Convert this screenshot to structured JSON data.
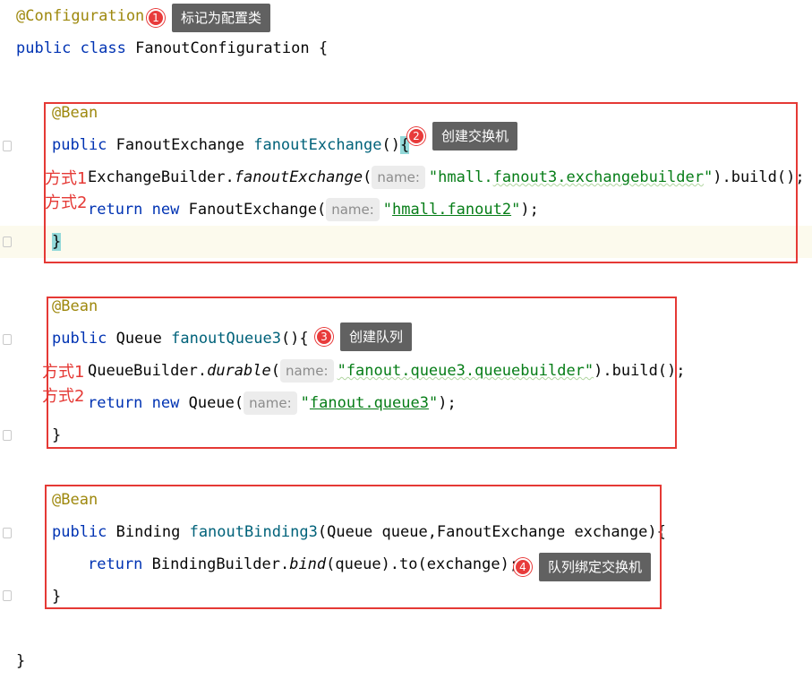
{
  "code": {
    "class_annotation": "@Configuration",
    "class_decl": {
      "public": "public",
      "class_kw": "class",
      "name": "FanoutConfiguration",
      "open": " {"
    },
    "bean_annotation": "@Bean",
    "hint_name": "name:",
    "exchange_method": {
      "public": "public",
      "type": "FanoutExchange",
      "name": "fanoutExchange",
      "parens": "()",
      "open_brace": "{",
      "builder_class": "ExchangeBuilder",
      "builder_method": "fanoutExchange",
      "builder_open": "(",
      "builder_arg_pre": "\"hmall.",
      "builder_arg_mid": "fanout3.exchangebuilder",
      "builder_arg_post": "\"",
      "builder_tail": ").build();",
      "return_kw": "return",
      "new_kw": "new",
      "ctor_type": "FanoutExchange",
      "ctor_open": "(",
      "ctor_arg_pre": "\"",
      "ctor_arg_mid": "hmall.fanout2",
      "ctor_arg_post": "\"",
      "ctor_tail": ");",
      "close_brace": "}"
    },
    "queue_method": {
      "public": "public",
      "type": "Queue",
      "name": "fanoutQueue3",
      "parens": "(){",
      "builder_class": "QueueBuilder",
      "builder_method": "durable",
      "builder_open": "(",
      "builder_arg": "\"fanout.queue3.queuebuilder\"",
      "builder_tail": ").build();",
      "return_kw": "return",
      "new_kw": "new",
      "ctor_type": "Queue",
      "ctor_open": "(",
      "ctor_arg_pre": "\"",
      "ctor_arg_mid": "fanout.queue3",
      "ctor_arg_post": "\"",
      "ctor_tail": ");",
      "close_brace": "}"
    },
    "binding_method": {
      "public": "public",
      "type": "Binding",
      "name": "fanoutBinding3",
      "params": "(Queue queue,FanoutExchange exchange){",
      "return_kw": "return",
      "builder_class": "BindingBuilder.",
      "bind_method": "bind",
      "bind_tail": "(queue).to(exchange);",
      "close_brace": "}"
    },
    "class_close": "}"
  },
  "callouts": [
    {
      "num": "1",
      "text": "标记为配置类"
    },
    {
      "num": "2",
      "text": "创建交换机"
    },
    {
      "num": "3",
      "text": "创建队列"
    },
    {
      "num": "4",
      "text": "队列绑定交换机"
    }
  ],
  "method_notes": {
    "exchange_way1": "方式1",
    "exchange_way2": "方式2",
    "queue_way1": "方式1",
    "queue_way2": "方式2"
  },
  "colors": {
    "keyword": "#0033b3",
    "annotation": "#9e880d",
    "method_name": "#00627a",
    "string": "#067d17",
    "highlight_box": "#e53935",
    "callout_badge": "#e83b3b",
    "callout_tip": "#616161"
  }
}
